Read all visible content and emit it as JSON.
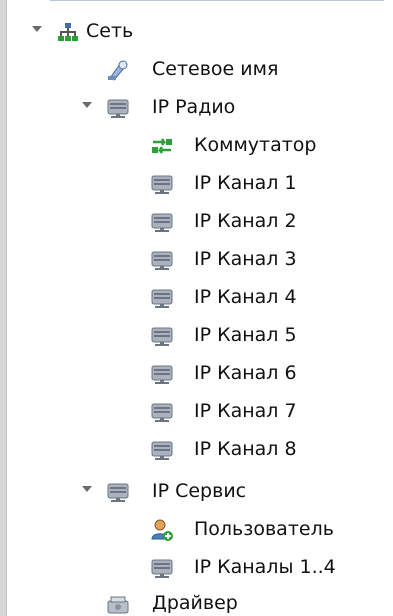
{
  "tree": {
    "nodes": [
      {
        "label": "Сеть",
        "icon": "network-icon",
        "expanded": true
      },
      {
        "label": "Сетевое имя",
        "icon": "network-name-icon"
      },
      {
        "label": "IP Радио",
        "icon": "server-icon",
        "expanded": true
      },
      {
        "label": "Коммутатор",
        "icon": "switch-icon"
      },
      {
        "label": "IP Канал 1",
        "icon": "server-icon"
      },
      {
        "label": "IP Канал 2",
        "icon": "server-icon"
      },
      {
        "label": "IP Канал 3",
        "icon": "server-icon"
      },
      {
        "label": "IP Канал 4",
        "icon": "server-icon"
      },
      {
        "label": "IP Канал 5",
        "icon": "server-icon"
      },
      {
        "label": "IP Канал 6",
        "icon": "server-icon"
      },
      {
        "label": "IP Канал 7",
        "icon": "server-icon"
      },
      {
        "label": "IP Канал 8",
        "icon": "server-icon"
      },
      {
        "label": "IP Сервис",
        "icon": "server-icon",
        "expanded": true
      },
      {
        "label": "Пользователь",
        "icon": "user-add-icon"
      },
      {
        "label": "IP Каналы 1..4",
        "icon": "server-icon"
      },
      {
        "label": "Драйвер",
        "icon": "driver-icon"
      }
    ]
  },
  "colors": {
    "accent_green": "#2e9e3a",
    "server_gray": "#7d8896",
    "network_blue": "#3c6fb0"
  }
}
